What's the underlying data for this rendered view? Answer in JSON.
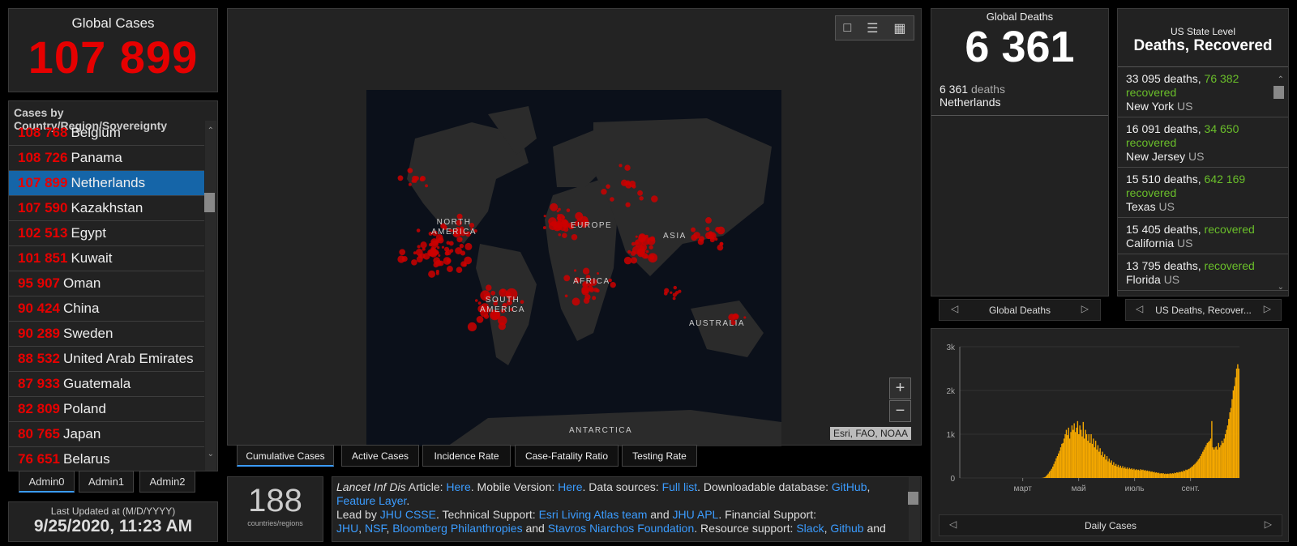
{
  "global_cases": {
    "title": "Global Cases",
    "value": "107 899"
  },
  "case_list": {
    "header": "Cases by Country/Region/Sovereignty",
    "rows": [
      {
        "n": "108 768",
        "c": "Belgium"
      },
      {
        "n": "108 726",
        "c": "Panama"
      },
      {
        "n": "107 899",
        "c": "Netherlands"
      },
      {
        "n": "107 590",
        "c": "Kazakhstan"
      },
      {
        "n": "102 513",
        "c": "Egypt"
      },
      {
        "n": "101 851",
        "c": "Kuwait"
      },
      {
        "n": "95 907",
        "c": "Oman"
      },
      {
        "n": "90 424",
        "c": "China"
      },
      {
        "n": "90 289",
        "c": "Sweden"
      },
      {
        "n": "88 532",
        "c": "United Arab Emirates"
      },
      {
        "n": "87 933",
        "c": "Guatemala"
      },
      {
        "n": "82 809",
        "c": "Poland"
      },
      {
        "n": "80 765",
        "c": "Japan"
      },
      {
        "n": "76 651",
        "c": "Belarus"
      }
    ],
    "selected_index": 2
  },
  "admin_tabs": [
    "Admin0",
    "Admin1",
    "Admin2"
  ],
  "updated": {
    "label": "Last Updated at (M/D/YYYY)",
    "value": "9/25/2020, 11:23 AM"
  },
  "map": {
    "labels": {
      "north_america": "NORTH\nAMERICA",
      "europe": "EUROPE",
      "asia": "ASIA",
      "africa": "AFRICA",
      "south_america": "SOUTH\nAMERICA",
      "australia": "AUSTRALIA",
      "antarctica": "ANTARCTICA"
    },
    "attribution": "Esri, FAO, NOAA",
    "zoom_in": "+",
    "zoom_out": "−",
    "tools": [
      "bookmark-icon",
      "list-icon",
      "qr-icon"
    ]
  },
  "map_tabs": [
    "Cumulative Cases",
    "Active Cases",
    "Incidence Rate",
    "Case-Fatality Ratio",
    "Testing Rate"
  ],
  "countries": {
    "value": "188",
    "label": "countries/regions"
  },
  "info": {
    "lancet": "Lancet Inf Dis",
    "t1": " Article: ",
    "here1": "Here",
    "t2": ". Mobile Version: ",
    "here2": "Here",
    "t3": ". Data sources: ",
    "fulllist": "Full list",
    "t4": ". Downloadable database: ",
    "github": "GitHub",
    "t5": ", ",
    "feature": "Feature Layer",
    "t6": ".",
    "t7": "Lead by ",
    "jhu": "JHU CSSE",
    "t8": ". Technical Support: ",
    "esri": "Esri Living Atlas team",
    "t9": " and ",
    "apl": "JHU APL",
    "t10": ". Financial Support: ",
    "jhu2": "JHU",
    "t11": ", ",
    "nsf": "NSF",
    "t12": ", ",
    "bloom": "Bloomberg Philanthropies",
    "t13": " and ",
    "stavros": "Stavros Niarchos Foundation",
    "t14": ". Resource support: ",
    "slack": "Slack",
    "t15": ", ",
    "github2": "Github",
    "t16": " and"
  },
  "global_deaths": {
    "title": "Global Deaths",
    "value": "6 361",
    "detail_num": "6 361",
    "detail_word": "deaths",
    "detail_country": "Netherlands",
    "nav_label": "Global Deaths"
  },
  "us": {
    "title_small": "US State Level",
    "title_big": "Deaths, Recovered",
    "rows": [
      {
        "deaths": "33 095 deaths,",
        "recovered": "76 382",
        "rec_word": "recovered",
        "state": "New York",
        "country": "US"
      },
      {
        "deaths": "16 091 deaths,",
        "recovered": "34 650",
        "rec_word": "recovered",
        "state": "New Jersey",
        "country": "US"
      },
      {
        "deaths": "15 510 deaths,",
        "recovered": "642 169",
        "rec_word": "recovered",
        "state": "Texas",
        "country": "US"
      },
      {
        "deaths": "15 405 deaths,",
        "recovered": "",
        "rec_word": "recovered",
        "state": "California",
        "country": "US"
      },
      {
        "deaths": "13 795 deaths,",
        "recovered": "",
        "rec_word": "recovered",
        "state": "Florida",
        "country": "US"
      }
    ],
    "nav_label": "US Deaths, Recover..."
  },
  "daily_chart": {
    "nav_label": "Daily Cases",
    "colors": {
      "bar": "#f5a800",
      "axis": "#999"
    }
  },
  "chart_data": {
    "type": "bar",
    "title": "",
    "xlabel": "",
    "ylabel": "",
    "ylim": [
      0,
      3000
    ],
    "y_ticks": [
      "0",
      "1k",
      "2k",
      "3k"
    ],
    "x_tick_labels": [
      "март",
      "май",
      "июль",
      "сент."
    ],
    "values": [
      0,
      0,
      0,
      0,
      0,
      0,
      0,
      0,
      0,
      0,
      0,
      0,
      0,
      0,
      0,
      0,
      0,
      0,
      0,
      0,
      0,
      0,
      0,
      0,
      0,
      0,
      0,
      0,
      0,
      0,
      0,
      0,
      0,
      0,
      0,
      0,
      0,
      0,
      0,
      0,
      0,
      0,
      0,
      0,
      0,
      0,
      0,
      0,
      0,
      0,
      0,
      0,
      0,
      0,
      0,
      0,
      0,
      0,
      0,
      0,
      0,
      0,
      0,
      0,
      0,
      0,
      0,
      0,
      0,
      0,
      0,
      0,
      0,
      5,
      10,
      20,
      40,
      70,
      100,
      140,
      170,
      210,
      260,
      320,
      380,
      450,
      500,
      560,
      620,
      700,
      780,
      800,
      900,
      1000,
      1100,
      980,
      1150,
      900,
      1050,
      1200,
      1100,
      1250,
      1050,
      1150,
      1300,
      1000,
      1200,
      1100,
      950,
      1280,
      900,
      1100,
      1000,
      850,
      1000,
      800,
      1000,
      780,
      900,
      700,
      850,
      650,
      750,
      600,
      680,
      520,
      600,
      480,
      540,
      420,
      500,
      380,
      440,
      350,
      400,
      300,
      360,
      280,
      320,
      260,
      300,
      240,
      280,
      230,
      270,
      220,
      250,
      210,
      240,
      200,
      230,
      200,
      220,
      190,
      210,
      180,
      200,
      180,
      190,
      170,
      200,
      180,
      190,
      170,
      180,
      160,
      170,
      150,
      160,
      140,
      150,
      130,
      140,
      120,
      130,
      110,
      120,
      100,
      110,
      100,
      110,
      90,
      100,
      90,
      100,
      90,
      110,
      90,
      110,
      100,
      120,
      110,
      130,
      120,
      140,
      130,
      150,
      140,
      170,
      160,
      190,
      180,
      200,
      210,
      230,
      250,
      270,
      300,
      320,
      350,
      380,
      420,
      450,
      500,
      550,
      600,
      650,
      700,
      750,
      800,
      820,
      850,
      900,
      1300,
      700,
      650,
      700,
      720,
      650,
      800,
      700,
      750,
      850,
      800,
      900,
      1000,
      1100,
      1200,
      1350,
      1500,
      1600,
      1800,
      2000,
      2100,
      2300,
      2500,
      2600,
      2500
    ]
  }
}
